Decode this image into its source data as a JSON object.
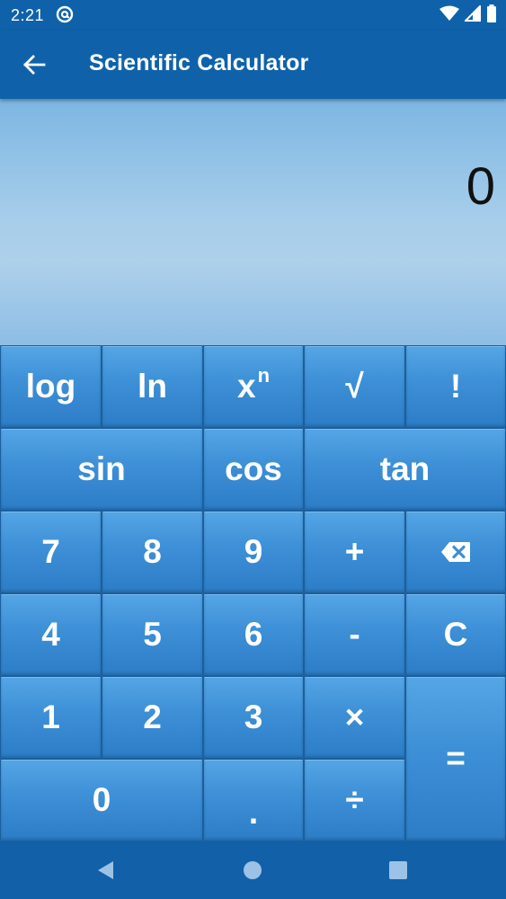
{
  "status_bar": {
    "time": "2:21"
  },
  "app_bar": {
    "title": "Scientific Calculator"
  },
  "display": {
    "value": "0"
  },
  "keys": {
    "log": "log",
    "ln": "ln",
    "power_base": "x",
    "power_exp": "n",
    "sqrt": "√",
    "factorial": "!",
    "sin": "sin",
    "cos": "cos",
    "tan": "tan",
    "seven": "7",
    "eight": "8",
    "nine": "9",
    "plus": "+",
    "four": "4",
    "five": "5",
    "six": "6",
    "minus": "-",
    "clear": "C",
    "one": "1",
    "two": "2",
    "three": "3",
    "multiply": "×",
    "equals": "=",
    "zero": "0",
    "decimal": ".",
    "divide": "÷"
  },
  "colors": {
    "bar": "#0f62aa",
    "key": "#3d8fd6",
    "display_top": "#7db6e3"
  }
}
